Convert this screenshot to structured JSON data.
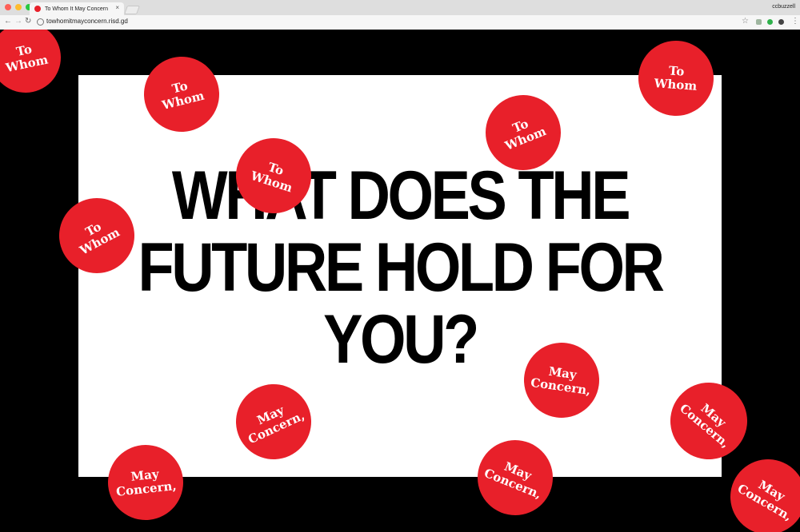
{
  "browser": {
    "tab_title": "To Whom It May Concern",
    "tab_close": "×",
    "user_name": "ccbuzzell",
    "url": "towhomitmayconcern.risd.gd",
    "back_icon": "←",
    "forward_icon": "→",
    "reload_icon": "↻",
    "star_icon": "☆",
    "menu_icon": "⋮",
    "traffic_lights": [
      "#ff5f57",
      "#febc2e",
      "#28c840"
    ],
    "favicon_color": "#e8202a"
  },
  "page": {
    "headline_lines": [
      "WHAT DOES THE",
      "FUTURE HOLD FOR",
      "YOU?"
    ],
    "accent_color": "#e8202a",
    "stickers": [
      {
        "line1": "To",
        "line2": "Whom"
      },
      {
        "line1": "To",
        "line2": "Whom"
      },
      {
        "line1": "To",
        "line2": "Whom"
      },
      {
        "line1": "To",
        "line2": "Whom"
      },
      {
        "line1": "To",
        "line2": "Whom"
      },
      {
        "line1": "To",
        "line2": "Whom"
      },
      {
        "line1": "May",
        "line2": "Concern,"
      },
      {
        "line1": "May",
        "line2": "Concern,"
      },
      {
        "line1": "May",
        "line2": "Concern,"
      },
      {
        "line1": "May",
        "line2": "Concern,"
      },
      {
        "line1": "May",
        "line2": "Concern,"
      },
      {
        "line1": "May",
        "line2": "Concern,"
      }
    ]
  }
}
